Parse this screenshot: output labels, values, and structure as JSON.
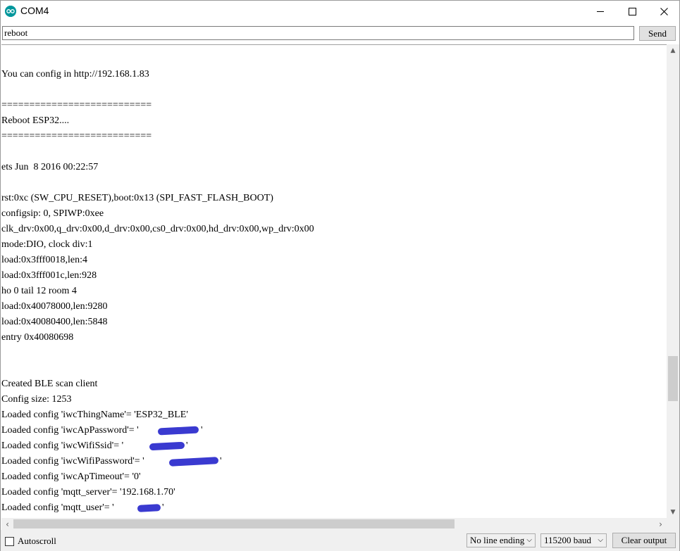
{
  "window": {
    "title": "COM4"
  },
  "input": {
    "value": "reboot",
    "send_label": "Send"
  },
  "output": {
    "lines": [
      "You can config in http://192.168.1.83",
      "===========================",
      "Reboot ESP32....",
      "===========================",
      "ets Jun  8 2016 00:22:57",
      "rst:0xc (SW_CPU_RESET),boot:0x13 (SPI_FAST_FLASH_BOOT)",
      "configsip: 0, SPIWP:0xee",
      "clk_drv:0x00,q_drv:0x00,d_drv:0x00,cs0_drv:0x00,hd_drv:0x00,wp_drv:0x00",
      "mode:DIO, clock div:1",
      "load:0x3fff0018,len:4",
      "load:0x3fff001c,len:928",
      "ho 0 tail 12 room 4",
      "load:0x40078000,len:9280",
      "load:0x40080400,len:5848",
      "entry 0x40080698",
      "Created BLE scan client",
      "Config size: 1253",
      "Loaded config 'iwcThingName'= 'ESP32_BLE'",
      "Loaded config 'iwcApPassword'= '",
      "Loaded config 'iwcWifiSsid'= '",
      "Loaded config 'iwcWifiPassword'= '",
      "Loaded config 'iwcApTimeout'= '0'",
      "Loaded config 'mqtt_server'= '192.168.1.70'",
      "Loaded config 'mqtt_user'= '"
    ]
  },
  "bottom": {
    "autoscroll_label": "Autoscroll",
    "autoscroll_checked": false,
    "line_ending": "No line ending",
    "baud": "115200 baud",
    "clear_label": "Clear output"
  },
  "colors": {
    "accent": "#00979c",
    "redaction": "#3a3ad0"
  }
}
